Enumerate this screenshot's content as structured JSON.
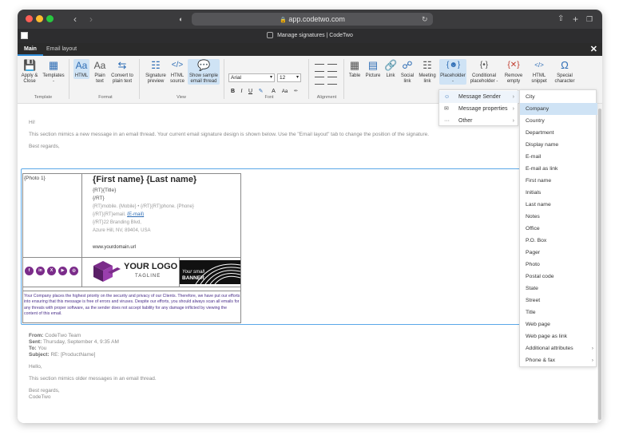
{
  "browser": {
    "url": "app.codetwo.com",
    "tab_title": "Manage signatures | CodeTwo"
  },
  "app_menu": {
    "tabs": [
      {
        "label": "Main"
      },
      {
        "label": "Email layout"
      }
    ],
    "close_label": "✕"
  },
  "ribbon": {
    "apply_close": "Apply &\nClose",
    "templates": "Templates",
    "templates_sub": "-",
    "html": "HTML",
    "plain_text": "Plain\ntext",
    "convert": "Convert to\nplain text",
    "sig_preview": "Signature\npreview",
    "html_source": "HTML\nsource",
    "show_sample": "Show sample\nemail thread",
    "font_name": "Arial",
    "font_size": "12",
    "bold": "B",
    "italic": "I",
    "underline": "U",
    "table": "Table",
    "picture": "Picture",
    "link": "Link",
    "social_link": "Social\nlink",
    "meeting_link": "Meeting\nlink",
    "placeholder": "Placeholder",
    "placeholder_sub": "-",
    "conditional": "Conditional\nplaceholder -",
    "remove_empty": "Remove\nempty",
    "html_snippet": "HTML\nsnippet",
    "special_char": "Special\ncharacter",
    "groups": {
      "template": "Template",
      "format": "Format",
      "view": "View",
      "font": "Font",
      "alignment": "Alignment"
    }
  },
  "email": {
    "greeting": "Hi!",
    "line1": "This section mimics a new message in an email thread. Your current email signature design is shown below. Use the \"Email layout\" tab to change the position of the signature.",
    "regards": "Best regards,",
    "from_label": "From:",
    "from_value": "CodeTwo Team",
    "sent_label": "Sent:",
    "sent_value": "Thursday, September 4, 9:35 AM",
    "to_label": "To:",
    "to_value": "You",
    "subject_label": "Subject:",
    "subject_value": "RE: [ProductName]",
    "hello": "Hello,",
    "line2": "This section mimics older messages in an email thread.",
    "regards2": "Best regards,",
    "sender": "CodeTwo"
  },
  "signature": {
    "photo": "{Photo 1}",
    "name": "{First name} {Last name}",
    "title": "{RT}{Title}",
    "rt": "{/RT}",
    "mobile": "{RT}mobile. {Mobile} • {/RT}{RT}phone. {Phone}",
    "email_prefix": "{/RT}{RT}email. ",
    "email_link": "{E-mail}",
    "street": "{/RT}22 Branding Blvd,",
    "city": "Azure Hill, NV, 89404, USA",
    "url": "www.yourdomain.url",
    "logo_main": "YOUR LOGO",
    "logo_tag": "TAGLINE",
    "banner_line1": "Your small",
    "banner_line2": "BANNER",
    "social": [
      "f",
      "in",
      "X",
      "▶",
      "◎"
    ],
    "disclaimer": "Your Company places the highest priority on the security and privacy of our Clients. Therefore, we have put our efforts into ensuring that this message is free of errors and viruses. Despite our efforts, you should always scan all emails for any threats with proper software, as the sender does not accept liability for any damage inflicted by viewing the content of this email."
  },
  "placeholder_menu": {
    "items": [
      {
        "label": "Message Sender",
        "icon": "☺"
      },
      {
        "label": "Message properties",
        "icon": "✉"
      },
      {
        "label": "Other",
        "icon": "···"
      }
    ]
  },
  "sender_menu": {
    "items": [
      {
        "label": "City"
      },
      {
        "label": "Company"
      },
      {
        "label": "Country"
      },
      {
        "label": "Department"
      },
      {
        "label": "Display name"
      },
      {
        "label": "E-mail"
      },
      {
        "label": "E-mail as link"
      },
      {
        "label": "First name"
      },
      {
        "label": "Initials"
      },
      {
        "label": "Last name"
      },
      {
        "label": "Notes"
      },
      {
        "label": "Office"
      },
      {
        "label": "P.O. Box"
      },
      {
        "label": "Pager"
      },
      {
        "label": "Photo"
      },
      {
        "label": "Postal code"
      },
      {
        "label": "State"
      },
      {
        "label": "Street"
      },
      {
        "label": "Title"
      },
      {
        "label": "Web page"
      },
      {
        "label": "Web page as link"
      },
      {
        "label": "Additional attributes"
      },
      {
        "label": "Phone & fax"
      }
    ],
    "highlighted": "Company"
  },
  "colors": {
    "accent": "#2e8cd8",
    "brand_purple": "#7b2c8a"
  }
}
